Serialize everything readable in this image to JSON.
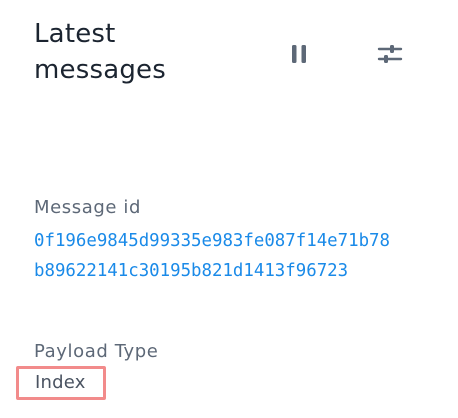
{
  "header": {
    "title_line1": "Latest",
    "title_line2": "messages",
    "pause_icon": "pause-icon",
    "filter_icon": "sliders-icon"
  },
  "message": {
    "id_label": "Message id",
    "id_value": "0f196e9845d99335e983fe087f14e71b78b89622141c30195b821d1413f96723",
    "payload_type_label": "Payload Type",
    "payload_type_value": "Index"
  },
  "colors": {
    "title": "#1b2430",
    "label": "#5d6877",
    "link": "#1a8ae8",
    "icon": "#5d6877",
    "highlight_border": "#f28b8b"
  }
}
